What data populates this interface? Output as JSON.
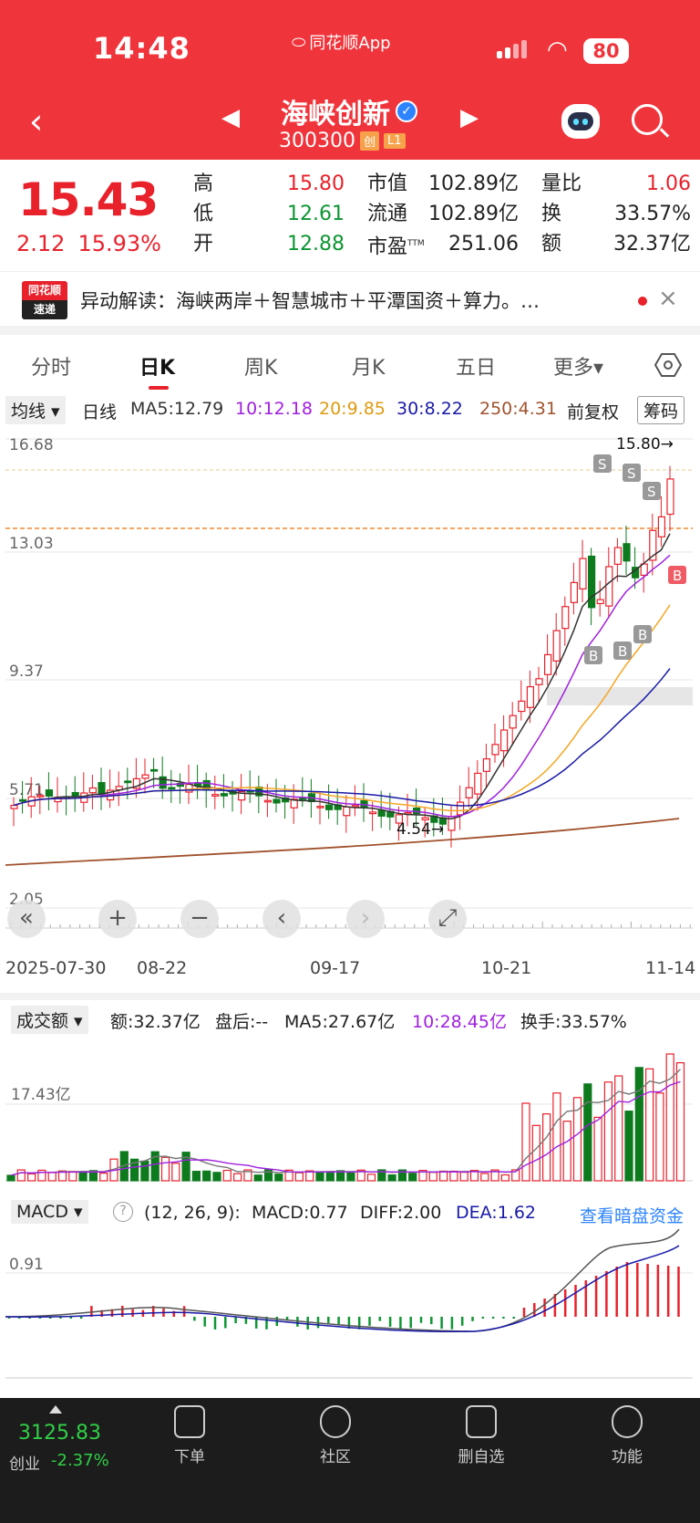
{
  "status": {
    "time": "14:48",
    "app": "同花顺App",
    "battery": "80"
  },
  "nav": {
    "back": "‹",
    "prev": "◀",
    "next": "▶",
    "name": "海峡创新",
    "code": "300300",
    "tag1": "创",
    "tag2": "L1"
  },
  "quote": {
    "price": "15.43",
    "change": "2.12",
    "pct": "15.93%",
    "high_label": "高",
    "high": "15.80",
    "low_label": "低",
    "low": "12.61",
    "open_label": "开",
    "open": "12.88",
    "mktcap_label": "市值",
    "mktcap": "102.89亿",
    "float_label": "流通",
    "float": "102.89亿",
    "pe_label": "市盈",
    "pe_sup": "TTM",
    "pe": "251.06",
    "vr_label": "量比",
    "vr": "1.06",
    "turn_label": "换",
    "turn": "33.57%",
    "amt_label": "额",
    "amt": "32.37亿"
  },
  "news": {
    "logo_top": "同花顺",
    "logo_bottom": "速递",
    "text": "异动解读：海峡两岸＋智慧城市＋平潭国资＋算力。…",
    "close": "×"
  },
  "tabs": [
    "分时",
    "日K",
    "周K",
    "月K",
    "五日",
    "更多▾"
  ],
  "ma": {
    "selector": "均线 ▾",
    "period": "日线",
    "ma5": "MA5:12.79",
    "ma10": "10:12.18",
    "ma20": "20:9.85",
    "ma30": "30:8.22",
    "ma250": "250:4.31",
    "adj": "前复权",
    "chips": "筹码"
  },
  "kline": {
    "y_labels": [
      "16.68",
      "13.03",
      "9.37",
      "5.71",
      "2.05"
    ],
    "high_mark": "15.80→",
    "low_mark": "4.54→",
    "colors": {
      "up": "#e8212b",
      "down": "#0d7a1e",
      "ma5": "#333333",
      "ma10": "#a020e0",
      "ma20": "#f5a623",
      "ma30": "#1a1aa8",
      "ma250": "#a0522d"
    }
  },
  "dates": [
    "2025-07-30",
    "08-22",
    "09-17",
    "10-21",
    "11-14"
  ],
  "volume": {
    "selector": "成交额 ▾",
    "amt": "额:32.37亿",
    "after": "盘后:--",
    "ma5": "MA5:27.67亿",
    "ma10": "10:28.45亿",
    "turnover": "换手:33.57%",
    "y_label": "17.43亿"
  },
  "macd": {
    "selector": "MACD ▾",
    "help": "?",
    "params": "(12, 26, 9):",
    "macd": "MACD:0.77",
    "diff": "DIFF:2.00",
    "dea": "DEA:1.62",
    "link": "查看暗盘资金",
    "y_label": "0.91"
  },
  "bottom": {
    "index": "3125.83",
    "index_name": "创业",
    "index_chg": "-2.37%",
    "buttons": [
      "下单",
      "社区",
      "删自选",
      "功能"
    ]
  }
}
